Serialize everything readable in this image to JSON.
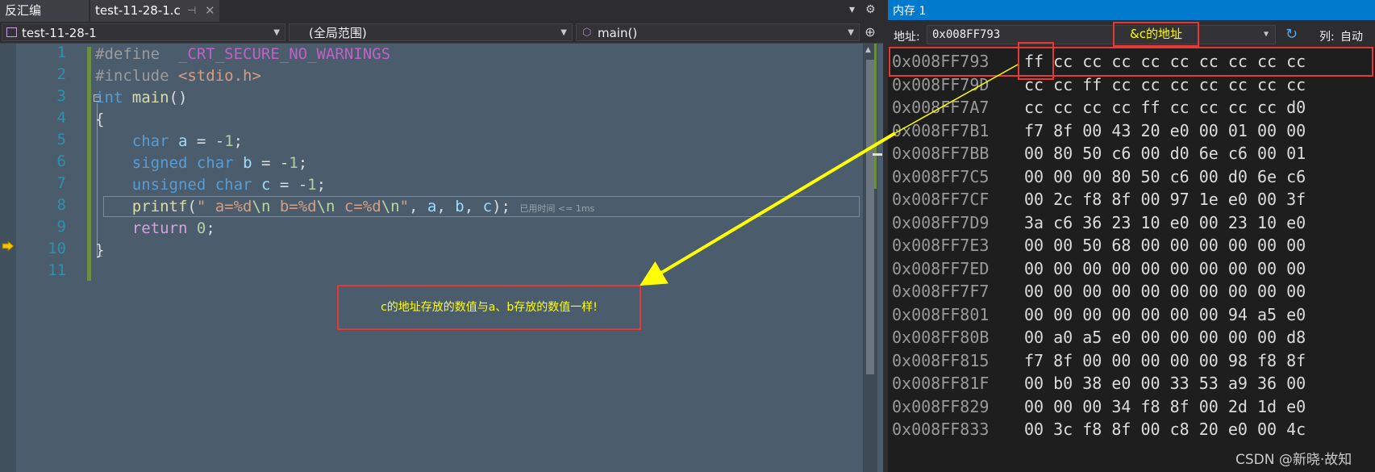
{
  "tabs": {
    "disasm": "反汇编",
    "file": "test-11-28-1.c"
  },
  "nav": {
    "project": "test-11-28-1",
    "scope": "(全局范围)",
    "member": "main()"
  },
  "editor": {
    "line_numbers": [
      "1",
      "2",
      "3",
      "4",
      "5",
      "6",
      "7",
      "8",
      "9",
      "10",
      "11"
    ],
    "perf_hint": "已用时间 <= 1ms"
  },
  "annotation": {
    "code_note": "c的地址存放的数值与a、b存放的数值一样!",
    "addr_note": "&c的地址"
  },
  "memory": {
    "title": "内存 1",
    "address_label": "地址:",
    "address_value": "0x008FF793",
    "columns_label": "列:",
    "columns_value": "自动",
    "rows": [
      {
        "addr": "0x008FF793",
        "bytes": "ff cc cc cc cc cc cc cc cc cc"
      },
      {
        "addr": "0x008FF79D",
        "bytes": "cc cc ff cc cc cc cc cc cc cc"
      },
      {
        "addr": "0x008FF7A7",
        "bytes": "cc cc cc cc ff cc cc cc cc d0"
      },
      {
        "addr": "0x008FF7B1",
        "bytes": "f7 8f 00 43 20 e0 00 01 00 00"
      },
      {
        "addr": "0x008FF7BB",
        "bytes": "00 80 50 c6 00 d0 6e c6 00 01"
      },
      {
        "addr": "0x008FF7C5",
        "bytes": "00 00 00 80 50 c6 00 d0 6e c6"
      },
      {
        "addr": "0x008FF7CF",
        "bytes": "00 2c f8 8f 00 97 1e e0 00 3f"
      },
      {
        "addr": "0x008FF7D9",
        "bytes": "3a c6 36 23 10 e0 00 23 10 e0"
      },
      {
        "addr": "0x008FF7E3",
        "bytes": "00 00 50 68 00 00 00 00 00 00"
      },
      {
        "addr": "0x008FF7ED",
        "bytes": "00 00 00 00 00 00 00 00 00 00"
      },
      {
        "addr": "0x008FF7F7",
        "bytes": "00 00 00 00 00 00 00 00 00 00"
      },
      {
        "addr": "0x008FF801",
        "bytes": "00 00 00 00 00 00 00 94 a5 e0"
      },
      {
        "addr": "0x008FF80B",
        "bytes": "00 a0 a5 e0 00 00 00 00 00 d8"
      },
      {
        "addr": "0x008FF815",
        "bytes": "f7 8f 00 00 00 00 00 98 f8 8f"
      },
      {
        "addr": "0x008FF81F",
        "bytes": "00 b0 38 e0 00 33 53 a9 36 00"
      },
      {
        "addr": "0x008FF829",
        "bytes": "00 00 00 34 f8 8f 00 2d 1d e0"
      },
      {
        "addr": "0x008FF833",
        "bytes": "00 3c f8 8f 00 c8 20 e0 00 4c"
      }
    ]
  },
  "watermark": "CSDN @新晓·故知",
  "colors": {
    "editor_bg": "#4b5d6c",
    "memory_title_bar": "#007acc",
    "annotation_box": "#e53935",
    "annotation_text": "#ffff00",
    "arrow": "#ffff00"
  }
}
